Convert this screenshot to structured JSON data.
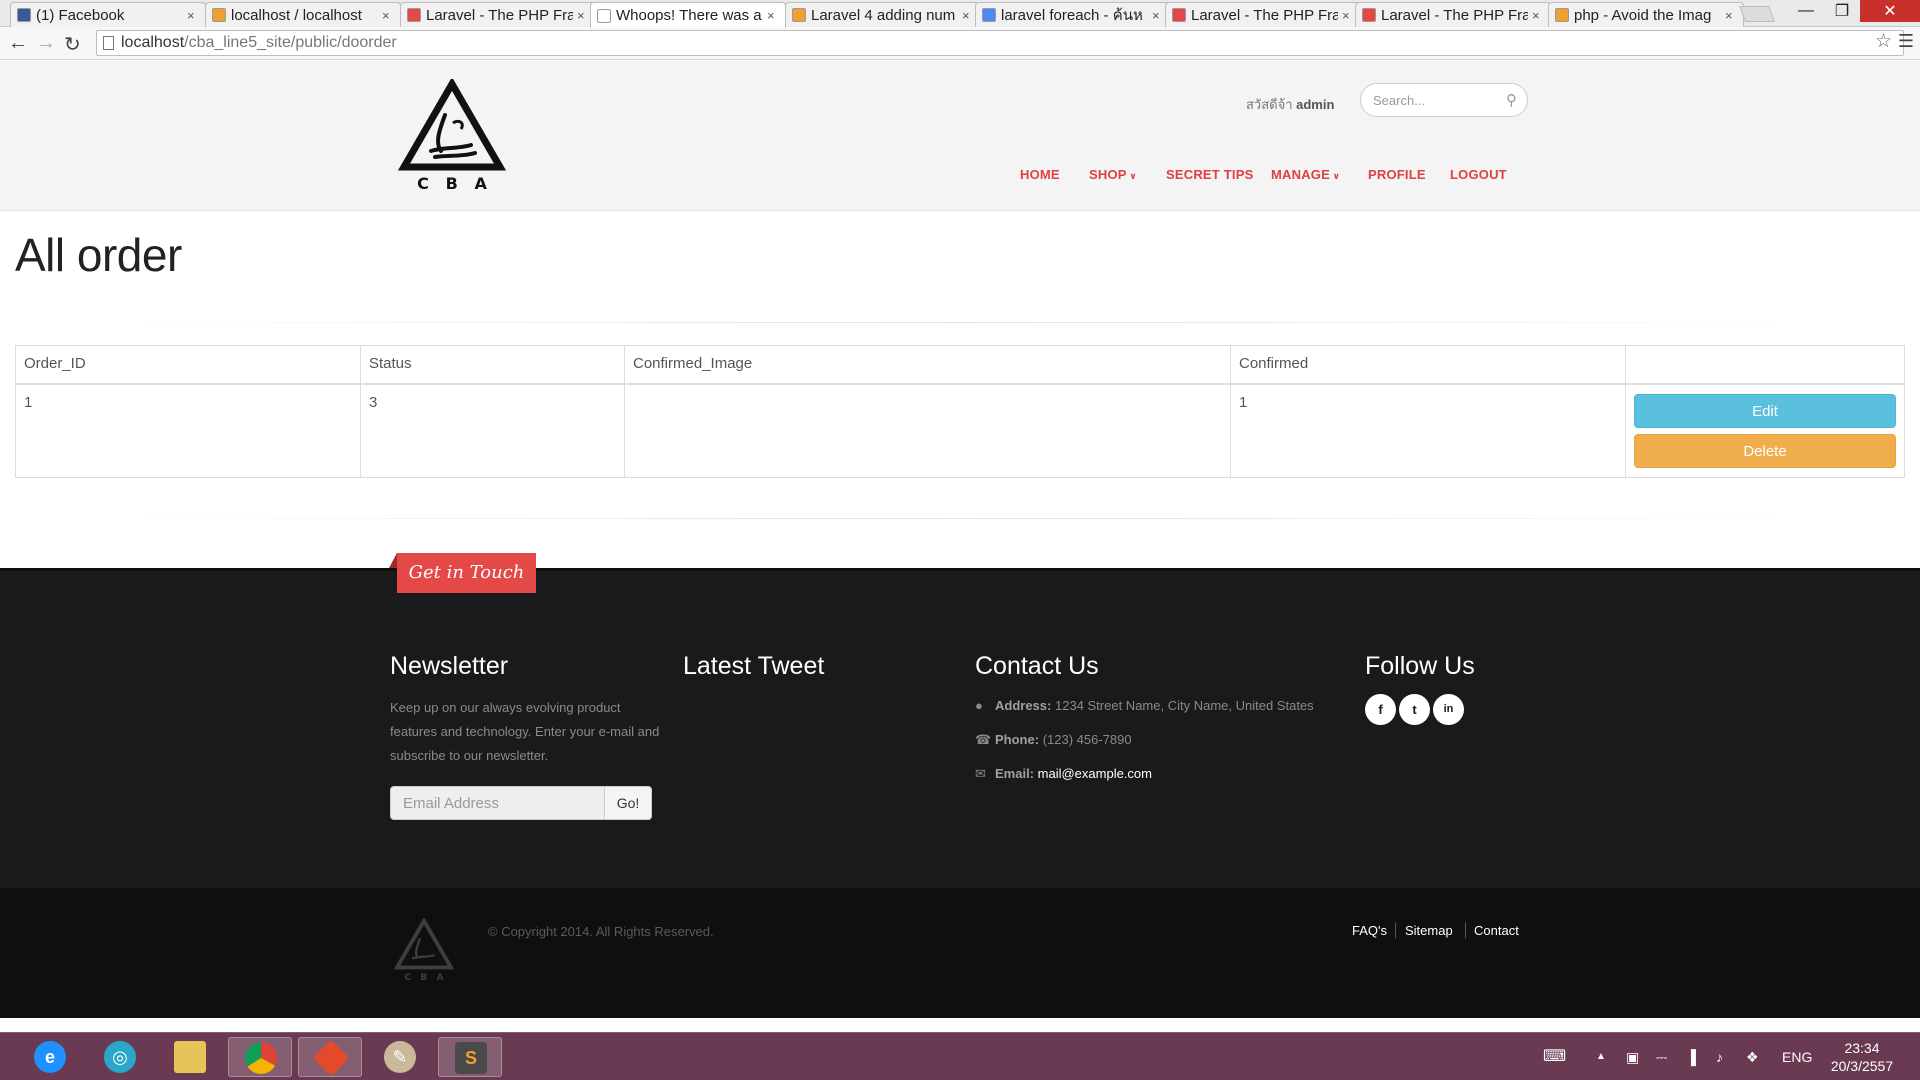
{
  "browser": {
    "tabs": [
      {
        "title": "(1) Facebook",
        "fav_color": "#3b5998"
      },
      {
        "title": "localhost / localhost",
        "fav_color": "#f0a030"
      },
      {
        "title": "Laravel - The PHP Fra",
        "fav_color": "#e34a47"
      },
      {
        "title": "Whoops! There was a",
        "fav_color": "#ffffff"
      },
      {
        "title": "Laravel 4 adding num",
        "fav_color": "#f0a030"
      },
      {
        "title": "laravel foreach - ค้นห",
        "fav_color": "#4a8af4"
      },
      {
        "title": "Laravel - The PHP Fra",
        "fav_color": "#e34a47"
      },
      {
        "title": "Laravel - The PHP Fra",
        "fav_color": "#e34a47"
      },
      {
        "title": "php - Avoid the Imag",
        "fav_color": "#f0a030"
      }
    ],
    "url_host": "localhost",
    "url_path": "/cba_line5_site/public/doorder"
  },
  "header": {
    "logo_letters": "C   B   A",
    "greeting_prefix": "สวัสดีจ้า ",
    "greeting_user": "admin",
    "search_placeholder": "Search...",
    "nav": [
      {
        "label": "HOME",
        "has_caret": false
      },
      {
        "label": "SHOP",
        "has_caret": true
      },
      {
        "label": "SECRET TIPS",
        "has_caret": false
      },
      {
        "label": "MANAGE",
        "has_caret": true
      },
      {
        "label": "PROFILE",
        "has_caret": false
      },
      {
        "label": "LOGOUT",
        "has_caret": false
      }
    ]
  },
  "main": {
    "title": "All order",
    "table": {
      "headers": [
        "Order_ID",
        "Status",
        "Confirmed_Image",
        "Confirmed",
        ""
      ],
      "rows": [
        {
          "order_id": "1",
          "status": "3",
          "confirmed_image": "",
          "confirmed": "1"
        }
      ],
      "edit_label": "Edit",
      "delete_label": "Delete"
    }
  },
  "footer": {
    "ribbon": "Get in Touch",
    "newsletter": {
      "title": "Newsletter",
      "text": "Keep up on our always evolving product features and technology. Enter your e-mail and subscribe to our newsletter.",
      "email_placeholder": "Email Address",
      "go_label": "Go!"
    },
    "tweet_title": "Latest Tweet",
    "contact": {
      "title": "Contact Us",
      "address_label": "Address:",
      "address": "1234 Street Name, City Name, United States",
      "phone_label": "Phone:",
      "phone": "(123) 456-7890",
      "email_label": "Email:",
      "email": "mail@example.com"
    },
    "follow": {
      "title": "Follow Us",
      "icons": [
        "f",
        "t",
        "in"
      ]
    },
    "copyright": "© Copyright 2014. All Rights Reserved.",
    "links": [
      "FAQ's",
      "Sitemap",
      "Contact"
    ]
  },
  "taskbar": {
    "lang": "ENG",
    "time": "23:34",
    "date": "20/3/2557"
  }
}
